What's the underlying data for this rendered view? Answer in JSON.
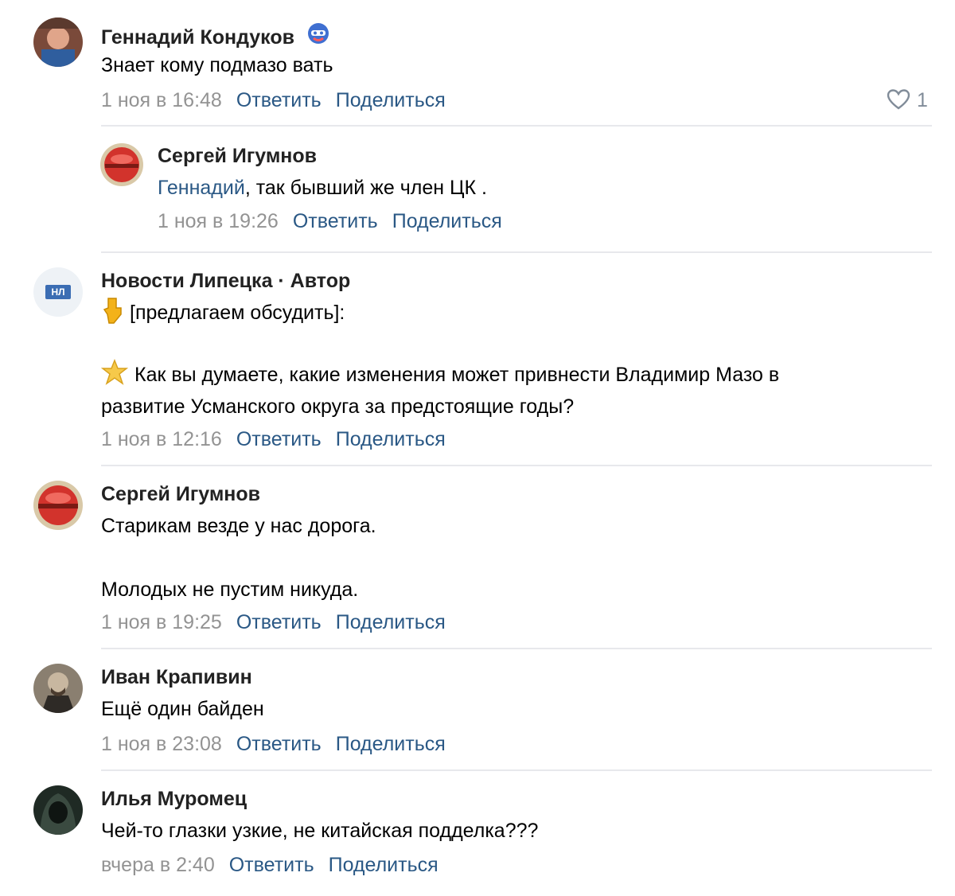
{
  "comments": [
    {
      "author": "Геннадий Кондуков",
      "text": "Знает кому подмазо вать",
      "date": "1 ноя в 16:48",
      "reply": "Ответить",
      "share": "Поделиться",
      "likes": "1"
    },
    {
      "author": "Сергей Игумнов",
      "mention": "Геннадий",
      "text": ", так бывший же член ЦК .",
      "date": "1 ноя в 19:26",
      "reply": "Ответить",
      "share": "Поделиться"
    },
    {
      "author": "Новости Липецка · Автор",
      "avatar_label": "НЛ",
      "line1": "[предлагаем обсудить]:",
      "line2": "Как вы думаете, какие изменения может привнести Владимир Мазо в",
      "line3": "развитие Усманского округа за предстоящие годы?",
      "date": "1 ноя в 12:16",
      "reply": "Ответить",
      "share": "Поделиться"
    },
    {
      "author": "Сергей Игумнов",
      "line1": "Старикам везде у нас дорога.",
      "line2": "Молодых не пустим никуда.",
      "date": "1 ноя в 19:25",
      "reply": "Ответить",
      "share": "Поделиться"
    },
    {
      "author": "Иван Крапивин",
      "text": "Ещё один байден",
      "date": "1 ноя в 23:08",
      "reply": "Ответить",
      "share": "Поделиться"
    },
    {
      "author": "Илья Муромец",
      "text": "Чей-то глазки узкие, не китайская подделка???",
      "date": "вчера в 2:40",
      "reply": "Ответить",
      "share": "Поделиться"
    }
  ],
  "colors": {
    "link": "#2a5885",
    "meta": "#939393",
    "divider": "#e7e8ec"
  },
  "icons": [
    "heart-icon",
    "pointing-down-emoji",
    "star-emoji",
    "badge-icon"
  ]
}
